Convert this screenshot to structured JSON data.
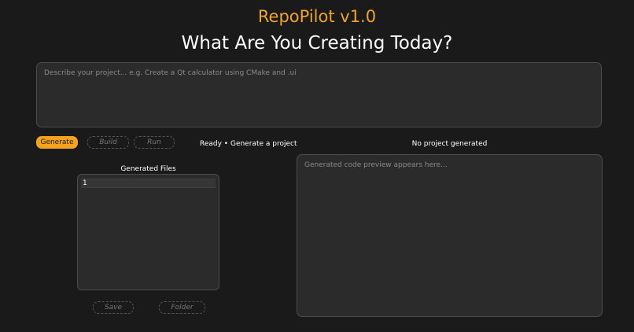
{
  "header": {
    "app_title": "RepoPilot v1.0",
    "headline": "What Are You Creating Today?"
  },
  "prompt": {
    "value": "",
    "placeholder": "Describe your project... e.g. Create a Qt calculator using CMake and .ui"
  },
  "toolbar": {
    "generate_label": "Generate",
    "build_label": "Build",
    "run_label": "Run"
  },
  "status": {
    "message": "Ready • Generate a project",
    "project": "No project generated"
  },
  "files": {
    "label": "Generated Files",
    "items": [
      "1"
    ]
  },
  "file_actions": {
    "save_label": "Save",
    "folder_label": "Folder"
  },
  "preview": {
    "value": "",
    "placeholder": "Generated code preview appears here..."
  },
  "colors": {
    "accent": "#f5a21e",
    "background": "#1a1a1a",
    "panel": "#2b2b2b"
  }
}
